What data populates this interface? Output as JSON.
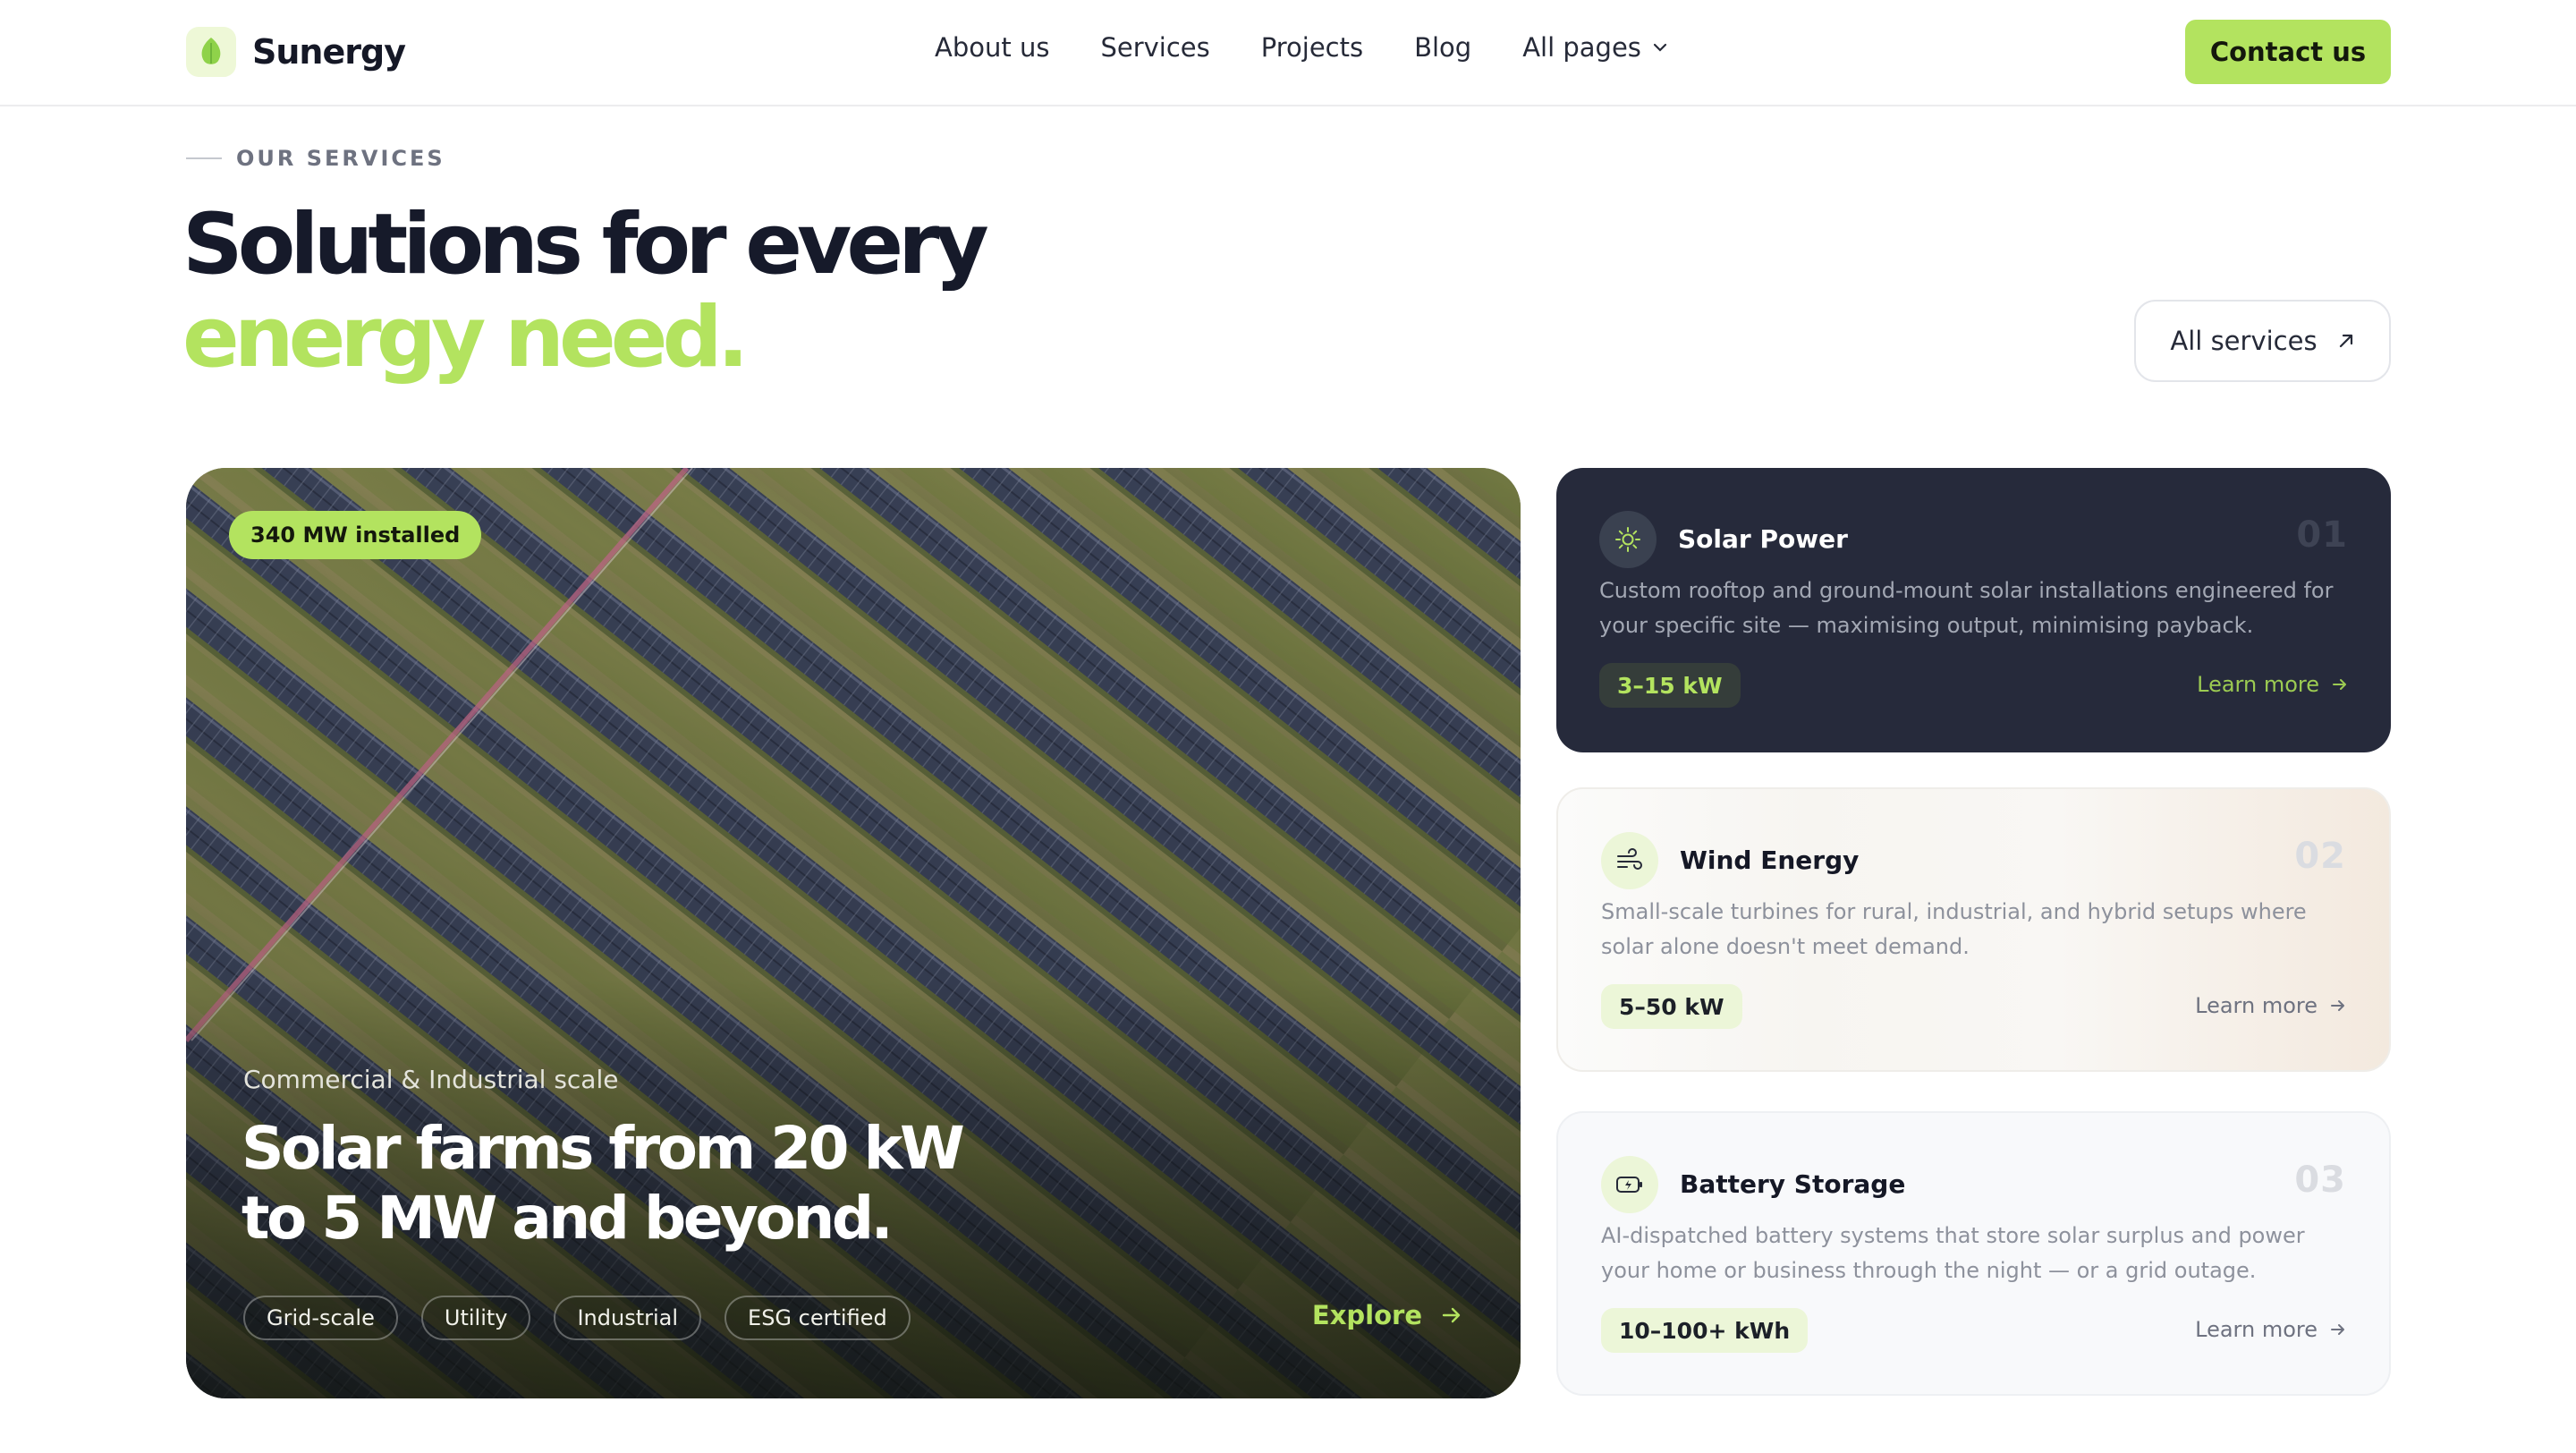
{
  "nav": {
    "brand": "Sunergy",
    "items": [
      {
        "label": "About us"
      },
      {
        "label": "Services"
      },
      {
        "label": "Projects"
      },
      {
        "label": "Blog"
      },
      {
        "label": "All pages"
      }
    ],
    "cta": "Contact us"
  },
  "header": {
    "eyebrow": "OUR SERVICES",
    "title_line1": "Solutions for every",
    "title_line2": "energy need.",
    "all_services": "All services"
  },
  "feature": {
    "badge": "340 MW installed",
    "kicker": "Commercial & Industrial scale",
    "title_line1": "Solar farms from 20 kW",
    "title_line2": "to 5 MW and beyond.",
    "tags": [
      "Grid-scale",
      "Utility",
      "Industrial",
      "ESG certified"
    ],
    "explore": "Explore"
  },
  "services": [
    {
      "icon": "sun-icon",
      "title": "Solar Power",
      "number": "01",
      "description": "Custom rooftop and ground-mount solar installations engineered for your specific site — maximising output, minimising payback.",
      "range": "3–15 kW",
      "more": "Learn more"
    },
    {
      "icon": "wind-icon",
      "title": "Wind Energy",
      "number": "02",
      "description": "Small-scale turbines for rural, industrial, and hybrid setups where solar alone doesn't meet demand.",
      "range": "5–50 kW",
      "more": "Learn more"
    },
    {
      "icon": "battery-icon",
      "title": "Battery Storage",
      "number": "03",
      "description": "AI-dispatched battery systems that store solar surplus and power your home or business through the night — or a grid outage.",
      "range": "10–100+ kWh",
      "more": "Learn more"
    }
  ],
  "colors": {
    "accent": "#b3e35f",
    "ink": "#161a2a",
    "dark_card": "#262a3b"
  }
}
